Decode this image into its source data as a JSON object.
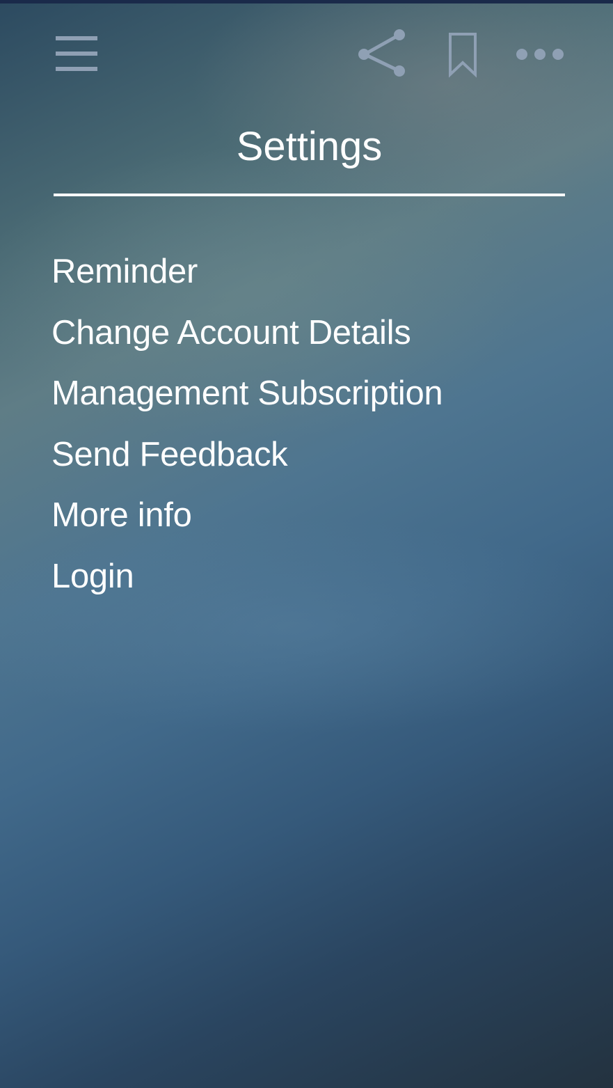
{
  "header": {
    "title": "Settings",
    "icons": {
      "menu": "hamburger-menu-icon",
      "share": "share-icon",
      "bookmark": "bookmark-icon",
      "more": "more-horizontal-icon"
    },
    "icon_color": "#8fa0b4"
  },
  "settings": {
    "items": [
      {
        "label": "Reminder"
      },
      {
        "label": "Change Account Details"
      },
      {
        "label": "Management Subscription"
      },
      {
        "label": "Send Feedback"
      },
      {
        "label": "More info"
      },
      {
        "label": "Login"
      }
    ]
  },
  "colors": {
    "text": "#ffffff",
    "top_accent": "#1a2a4a"
  }
}
